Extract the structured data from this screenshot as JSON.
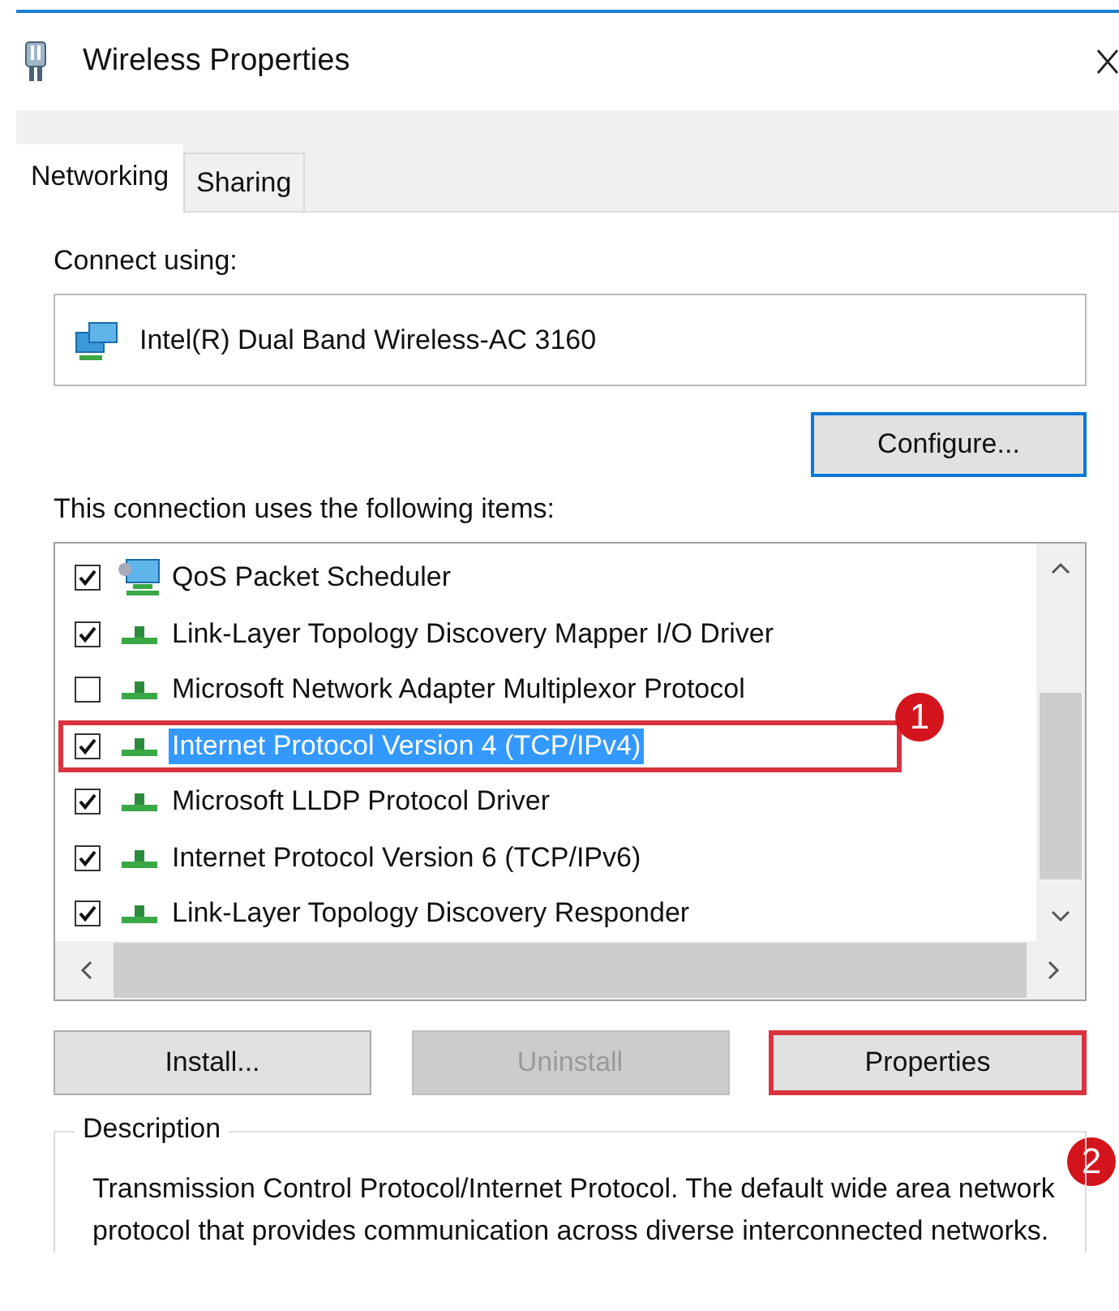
{
  "window": {
    "title": "Wireless Properties"
  },
  "tabs": [
    {
      "label": "Networking",
      "selected": true
    },
    {
      "label": "Sharing",
      "selected": false
    }
  ],
  "connect_using": {
    "label": "Connect using:",
    "adapter": "Intel(R) Dual Band Wireless-AC 3160",
    "button": "Configure..."
  },
  "items": {
    "label": "This connection uses the following items:",
    "rows": [
      {
        "kind": "service",
        "name": "QoS Packet Scheduler",
        "checked": true,
        "selected": false
      },
      {
        "kind": "protocol",
        "name": "Link-Layer Topology Discovery Mapper I/O Driver",
        "checked": true,
        "selected": false
      },
      {
        "kind": "protocol",
        "name": "Microsoft Network Adapter Multiplexor Protocol",
        "checked": false,
        "selected": false
      },
      {
        "kind": "protocol",
        "name": "Internet Protocol Version 4 (TCP/IPv4)",
        "checked": true,
        "selected": true,
        "highlighted": true,
        "callout": "1"
      },
      {
        "kind": "protocol",
        "name": "Microsoft LLDP Protocol Driver",
        "checked": true,
        "selected": false
      },
      {
        "kind": "protocol",
        "name": "Internet Protocol Version 6 (TCP/IPv6)",
        "checked": true,
        "selected": false
      },
      {
        "kind": "protocol",
        "name": "Link-Layer Topology Discovery Responder",
        "checked": true,
        "selected": false
      }
    ]
  },
  "buttons": [
    {
      "label": "Install...",
      "disabled": false,
      "highlighted": false
    },
    {
      "label": "Uninstall",
      "disabled": true,
      "highlighted": false
    },
    {
      "label": "Properties",
      "disabled": false,
      "highlighted": true,
      "callout": "2"
    }
  ],
  "description": {
    "label": "Description",
    "text": "Transmission Control Protocol/Internet Protocol. The default wide area network protocol that provides communication across diverse interconnected networks."
  }
}
